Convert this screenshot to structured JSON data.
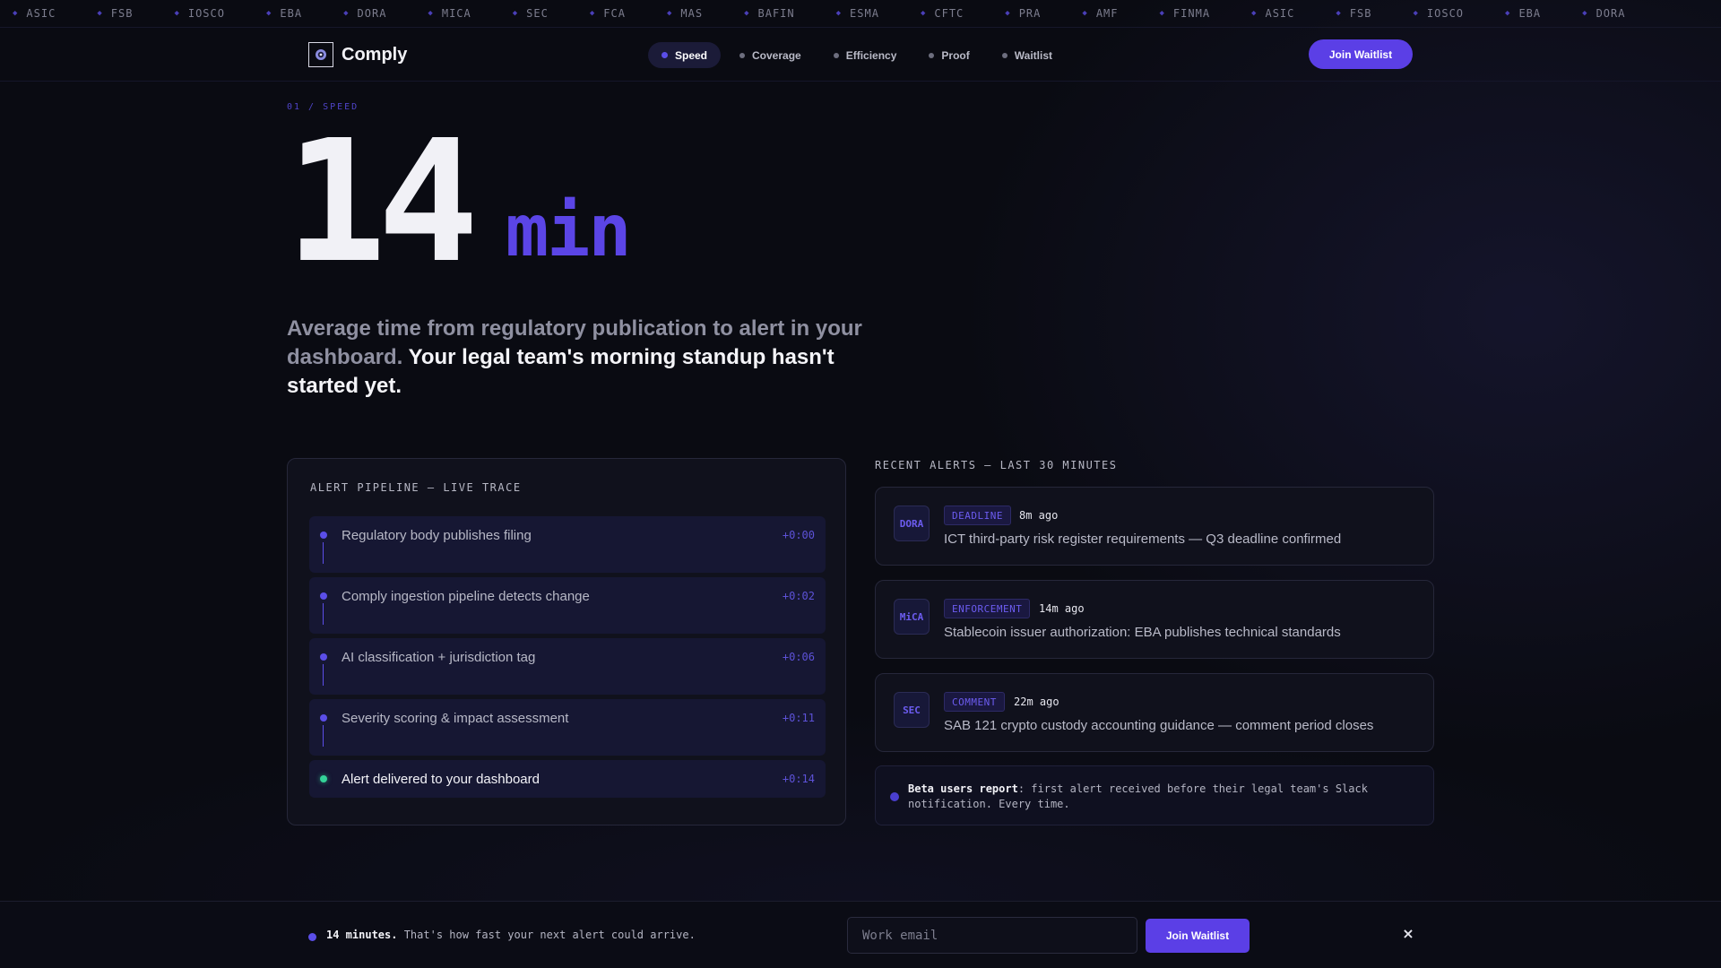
{
  "ticker": [
    "ASIC",
    "FSB",
    "IOSCO",
    "EBA",
    "DORA",
    "MICA",
    "SEC",
    "FCA",
    "MAS",
    "BAFIN",
    "ESMA",
    "CFTC",
    "PRA",
    "AMF",
    "FINMA",
    "ASIC",
    "FSB",
    "IOSCO",
    "EBA",
    "DORA"
  ],
  "nav": {
    "brand": "Comply",
    "links": [
      "Speed",
      "Coverage",
      "Efficiency",
      "Proof",
      "Waitlist"
    ],
    "cta": "Join Waitlist"
  },
  "hero": {
    "eyebrow": "01 / SPEED",
    "number": "14",
    "unit": "min",
    "lede_muted": "Average time from regulatory publication to alert in your dashboard.",
    "lede_strong": "Your legal team's morning standup hasn't started yet."
  },
  "pipeline": {
    "title": "ALERT PIPELINE — LIVE TRACE",
    "steps": [
      {
        "label": "Regulatory body publishes filing",
        "time": "+0:00"
      },
      {
        "label": "Comply ingestion pipeline detects change",
        "time": "+0:02"
      },
      {
        "label": "AI classification + jurisdiction tag",
        "time": "+0:06"
      },
      {
        "label": "Severity scoring & impact assessment",
        "time": "+0:11"
      },
      {
        "label": "Alert delivered to your dashboard",
        "time": "+0:14"
      }
    ]
  },
  "alerts": {
    "title": "RECENT ALERTS — LAST 30 MINUTES",
    "items": [
      {
        "badge": "DORA",
        "tag": "DEADLINE",
        "time": "8m ago",
        "text": "ICT third-party risk register requirements — Q3 deadline confirmed"
      },
      {
        "badge": "MiCA",
        "tag": "ENFORCEMENT",
        "time": "14m ago",
        "text": "Stablecoin issuer authorization: EBA publishes technical standards"
      },
      {
        "badge": "SEC",
        "tag": "COMMENT",
        "time": "22m ago",
        "text": "SAB 121 crypto custody accounting guidance — comment period closes"
      }
    ],
    "beta_bold": "Beta users report",
    "beta_text": ": first alert received before their legal team's Slack notification. Every time."
  },
  "bottom": {
    "bold": "14 minutes.",
    "text": " That's how fast your next alert could arrive.",
    "email_placeholder": "Work email",
    "cta": "Join Waitlist",
    "close": "×"
  },
  "colors": {
    "accent": "#5b3fe6",
    "success": "#34d399",
    "background": "#0a0b12"
  },
  "icons": {
    "brand": "comply-logo-icon",
    "close": "close-icon"
  }
}
